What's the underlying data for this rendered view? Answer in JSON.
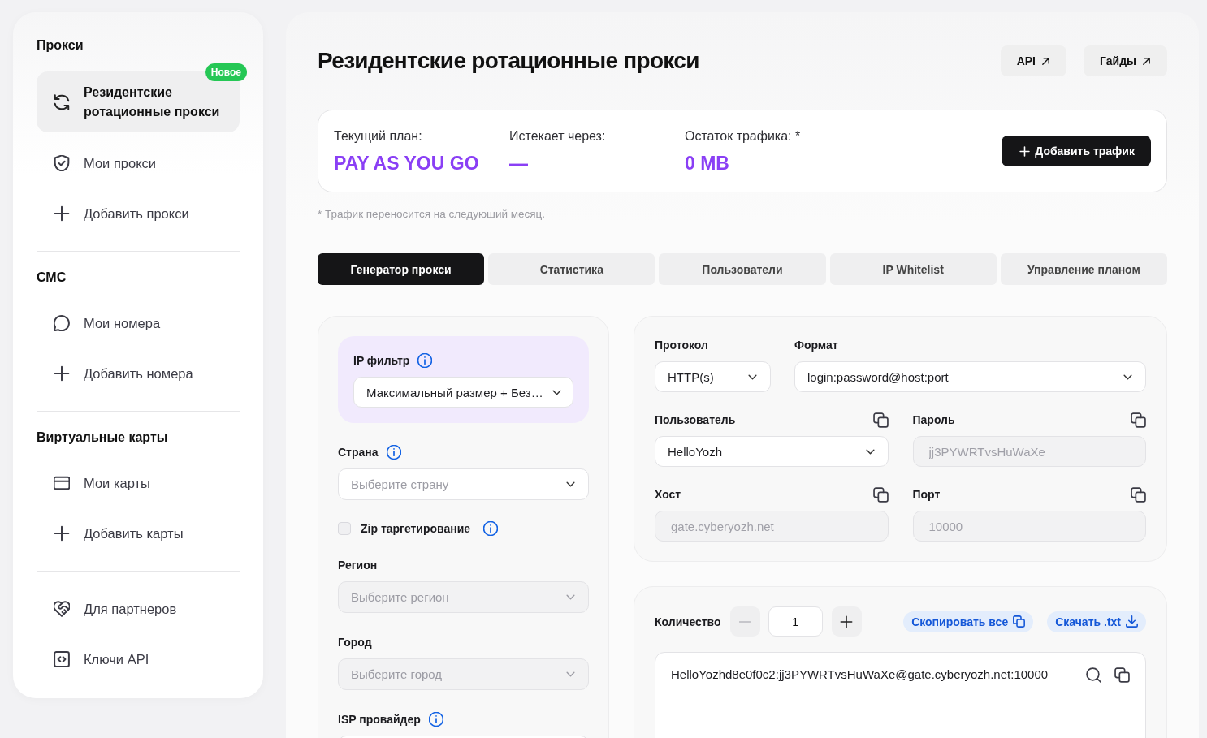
{
  "sidebar": {
    "sections": [
      {
        "title": "Прокси",
        "items": [
          {
            "label": "Резидентские ротационные прокси",
            "selected": true,
            "badge": "Новое"
          },
          {
            "label": "Мои прокси",
            "selected": false
          },
          {
            "label": "Добавить прокси",
            "selected": false
          }
        ]
      },
      {
        "title": "СМС",
        "items": [
          {
            "label": "Мои номера",
            "selected": false
          },
          {
            "label": "Добавить номера",
            "selected": false
          }
        ]
      },
      {
        "title": "Виртуальные карты",
        "items": [
          {
            "label": "Мои карты",
            "selected": false
          },
          {
            "label": "Добавить карты",
            "selected": false
          }
        ]
      },
      {
        "items": [
          {
            "label": "Для партнеров",
            "selected": false
          },
          {
            "label": "Ключи API",
            "selected": false
          }
        ]
      }
    ]
  },
  "header": {
    "title": "Резидентские ротационные прокси",
    "links": [
      {
        "label": "API"
      },
      {
        "label": "Гайды"
      }
    ]
  },
  "plan": {
    "stats": [
      {
        "label": "Текущий план:",
        "value": "PAY AS YOU GO"
      },
      {
        "label": "Истекает через:",
        "value": "—"
      },
      {
        "label": "Остаток трафика: *",
        "value": "0 MB"
      }
    ],
    "button": "Добавить трафик",
    "footnote": "* Трафик переносится на следуюший месяц."
  },
  "tabs": [
    {
      "label": "Генератор прокси",
      "selected": true
    },
    {
      "label": "Статистика",
      "selected": false
    },
    {
      "label": "Пользователи",
      "selected": false
    },
    {
      "label": "IP Whitelist",
      "selected": false
    },
    {
      "label": "Управление планом",
      "selected": false
    }
  ],
  "filters": {
    "ip_filter": {
      "label": "IP фильтр",
      "info": true,
      "value": "Максимальный размер + Без…"
    },
    "fields": [
      {
        "kind": "select",
        "label": "Страна",
        "info": true,
        "placeholder": "Выберите страну",
        "disabled": false
      },
      {
        "kind": "checkbox",
        "label": "Zip таргетирование",
        "info": true,
        "checked": false
      },
      {
        "kind": "select",
        "label": "Регион",
        "placeholder": "Выберите регион",
        "disabled": true
      },
      {
        "kind": "select",
        "label": "Город",
        "placeholder": "Выберите город",
        "disabled": true
      },
      {
        "kind": "select",
        "label": "ISP провайдер",
        "info": true
      }
    ]
  },
  "connection": {
    "rows": [
      [
        {
          "kind": "select",
          "label": "Протокол",
          "value": "HTTP(s)"
        },
        {
          "kind": "select",
          "label": "Формат",
          "value": "login:password@host:port"
        }
      ],
      [
        {
          "kind": "select",
          "label": "Пользователь",
          "value": "HelloYozh",
          "copy": true
        },
        {
          "kind": "text",
          "label": "Пароль",
          "value": "jj3PYWRTvsHuWaXe",
          "copy": true,
          "disabled": true
        }
      ],
      [
        {
          "kind": "text",
          "label": "Хост",
          "value": "gate.cyberyozh.net",
          "copy": true,
          "disabled": true
        },
        {
          "kind": "text",
          "label": "Порт",
          "value": "10000",
          "copy": true,
          "disabled": true
        }
      ]
    ]
  },
  "generator": {
    "quantity": {
      "label": "Количество",
      "value": "1",
      "decrease_disabled": true
    },
    "actions": [
      {
        "label": "Скопировать все"
      },
      {
        "label": "Скачать .txt"
      }
    ],
    "lines": [
      "HelloYozhd8e0f0c2:jj3PYWRTvsHuWaXe@gate.cyberyozh.net:10000"
    ]
  }
}
